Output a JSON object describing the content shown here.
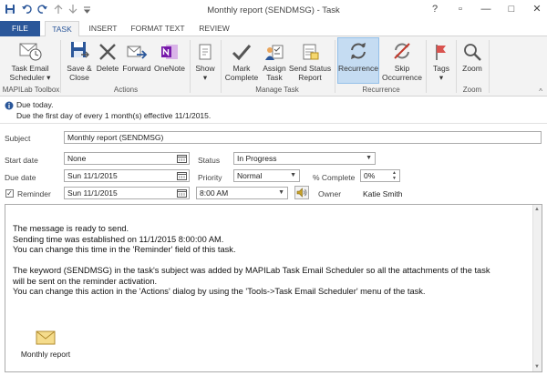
{
  "window": {
    "title": "Monthly report (SENDMSG) - Task",
    "help": "?",
    "restore": "▫",
    "minimize": "—",
    "maximize": "□",
    "close": "✕"
  },
  "tabs": [
    {
      "label": "FILE"
    },
    {
      "label": "TASK"
    },
    {
      "label": "INSERT"
    },
    {
      "label": "FORMAT TEXT"
    },
    {
      "label": "REVIEW"
    }
  ],
  "ribbon": {
    "task_email_scheduler": "Task Email\nScheduler ▾",
    "save_close": "Save &\nClose",
    "delete": "Delete",
    "forward": "Forward",
    "onenote": "OneNote",
    "show": "Show\n▾",
    "mark_complete": "Mark\nComplete",
    "assign_task": "Assign\nTask",
    "send_status_report": "Send Status\nReport",
    "recurrence": "Recurrence",
    "skip_occurrence": "Skip\nOccurrence",
    "tags": "Tags\n▾",
    "zoom": "Zoom",
    "groups": {
      "mapilab": "MAPILab Toolbox",
      "actions": "Actions",
      "manage_task": "Manage Task",
      "recurrence": "Recurrence",
      "zoom": "Zoom"
    },
    "collapse": "^"
  },
  "info": {
    "line1": "Due today.",
    "line2": "Due the first day of every 1 month(s) effective 11/1/2015."
  },
  "form": {
    "subject_label": "Subject",
    "subject_value": "Monthly report (SENDMSG)",
    "start_label": "Start date",
    "start_value": "None",
    "status_label": "Status",
    "status_value": "In Progress",
    "due_label": "Due date",
    "due_value": "Sun 11/1/2015",
    "priority_label": "Priority",
    "priority_value": "Normal",
    "complete_label": "% Complete",
    "complete_value": "0%",
    "reminder_label": "Reminder",
    "reminder_checked": "✓",
    "reminder_date": "Sun 11/1/2015",
    "reminder_time": "8:00 AM",
    "owner_label": "Owner",
    "owner_value": "Katie Smith"
  },
  "body": {
    "p1": "The message is ready to send.\nSending time was established on 11/1/2015 8:00:00 AM.\nYou can change this time in the 'Reminder' field of this task.",
    "p2": "The keyword (SENDMSG) in the task's subject was added by MAPILab Task Email Scheduler so all the attachments of the task\nwill be sent on the reminder activation.\nYou can change this action in the 'Actions' dialog by using the 'Tools->Task Email Scheduler' menu of the task.",
    "attachment": "Monthly report"
  },
  "colors": {
    "accent": "#2b579a",
    "ribbon_bg": "#f3f3f3",
    "active_button": "#c5dcf2"
  }
}
